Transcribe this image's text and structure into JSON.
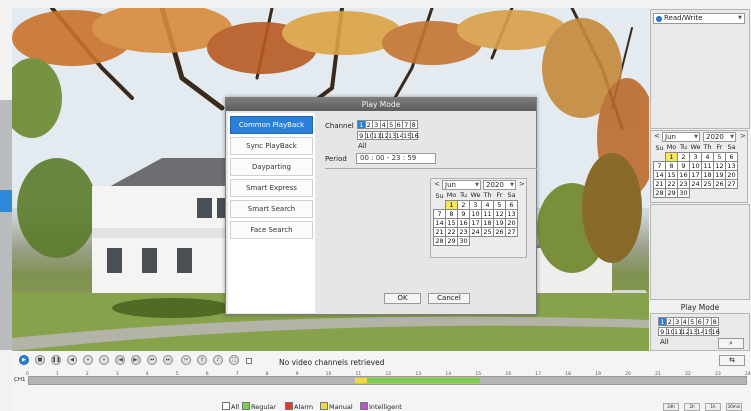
{
  "colors": {
    "accent": "#2b7fd4",
    "record_regular": "#7ccf4a",
    "record_manual": "#f0dc3a",
    "record_alarm": "#e03a2a",
    "record_intelligent": "#b05ac7"
  },
  "dialog": {
    "title": "Play Mode",
    "menu": [
      "Common PlayBack",
      "Sync PlayBack",
      "Dayparting",
      "Smart Express",
      "Smart Search",
      "Face Search"
    ],
    "channel_label": "Channel",
    "channels_row1": [
      "1",
      "2",
      "3",
      "4",
      "5",
      "6",
      "7",
      "8"
    ],
    "channels_row2": [
      "9",
      "10",
      "11",
      "12",
      "13",
      "14",
      "15",
      "16"
    ],
    "all_label": "All",
    "period_label": "Period",
    "period_value": "00 : 00    -   23 : 59",
    "ok_label": "OK",
    "cancel_label": "Cancel"
  },
  "calendar": {
    "month": "Jun",
    "year": "2020",
    "prev": "<",
    "next": ">",
    "weekdays": [
      "Su",
      "Mo",
      "Tu",
      "We",
      "Th",
      "Fr",
      "Sa"
    ],
    "weeks": [
      [
        "",
        "1",
        "2",
        "3",
        "4",
        "5",
        "6"
      ],
      [
        "7",
        "8",
        "9",
        "10",
        "11",
        "12",
        "13"
      ],
      [
        "14",
        "15",
        "16",
        "17",
        "18",
        "19",
        "20"
      ],
      [
        "21",
        "22",
        "23",
        "24",
        "25",
        "26",
        "27"
      ],
      [
        "28",
        "29",
        "30",
        "",
        "",
        "",
        ""
      ]
    ],
    "recorded_days": [
      "1"
    ]
  },
  "right_panel": {
    "mode_value": "Read/Write",
    "play_mode_title": "Play Mode",
    "all_label": "All",
    "search_icon": "magnifier"
  },
  "bottom": {
    "no_video_text": "No video channels retrieved",
    "channel_label": "CH1",
    "hours": [
      "0",
      "1",
      "2",
      "3",
      "4",
      "5",
      "6",
      "7",
      "8",
      "9",
      "10",
      "11",
      "12",
      "13",
      "14",
      "15",
      "16",
      "17",
      "18",
      "19",
      "20",
      "21",
      "22",
      "23",
      "24"
    ],
    "legend": [
      "All",
      "Regular",
      "Alarm",
      "Manual",
      "Intelligent"
    ],
    "zoom_buttons": [
      "24h",
      "2h",
      "1h",
      "30min"
    ],
    "recorded_segments": [
      {
        "start_hour": 10.9,
        "end_hour": 11.3,
        "type": "manual"
      },
      {
        "start_hour": 11.3,
        "end_hour": 15.1,
        "type": "regular"
      }
    ]
  }
}
